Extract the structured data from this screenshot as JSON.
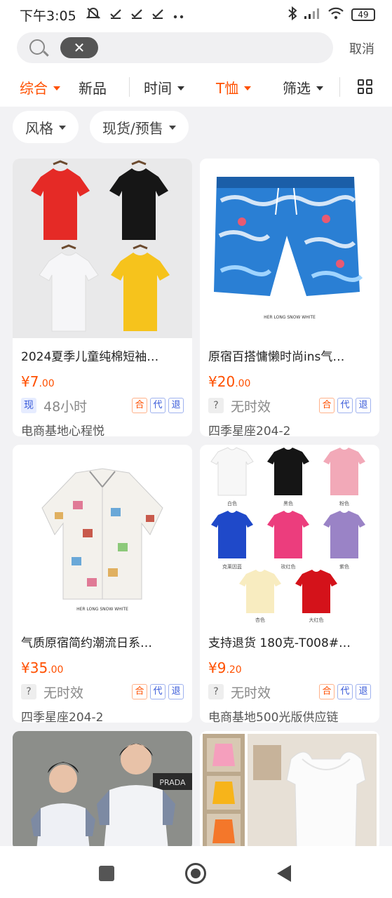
{
  "status": {
    "time": "下午3:05",
    "battery": "49"
  },
  "search": {
    "clear": "✕",
    "cancel": "取消"
  },
  "filters": [
    {
      "label": "综合"
    },
    {
      "label": "新品"
    },
    {
      "label": "时间"
    },
    {
      "label": "T恤"
    },
    {
      "label": "筛选"
    }
  ],
  "chips": [
    {
      "label": "风格"
    },
    {
      "label": "现货/预售"
    }
  ],
  "products": [
    {
      "title": "2024夏季儿童纯棉短袖…",
      "price_int": "¥7",
      "price_dec": ".00",
      "badge": "现",
      "stock": "48小时",
      "store": "电商基地心程悦"
    },
    {
      "title": "原宿百搭慵懒时尚ins气…",
      "price_int": "¥20",
      "price_dec": ".00",
      "badge": "?",
      "stock": "无时效",
      "store": "四季星座204-2"
    },
    {
      "title": "气质原宿简约潮流日系…",
      "price_int": "¥35",
      "price_dec": ".00",
      "badge": "?",
      "stock": "无时效",
      "store": "四季星座204-2"
    },
    {
      "title": "支持退货 180克-T008#…",
      "price_int": "¥9",
      "price_dec": ".20",
      "badge": "?",
      "stock": "无时效",
      "store": "电商基地500光版供应链"
    }
  ],
  "tags": {
    "he": "合",
    "dai": "代",
    "tui": "退"
  },
  "image_text": {
    "shorts_caption": "HER LONG SNOW WHITE",
    "shirt_caption": "HER LONG SNOW WHITE",
    "colors": [
      "白色",
      "黑色",
      "粉色",
      "克莱因蓝",
      "玫红色",
      "紫色",
      "杏色",
      "大红色"
    ],
    "prada": "PRADA"
  },
  "accent": "#ff5000"
}
